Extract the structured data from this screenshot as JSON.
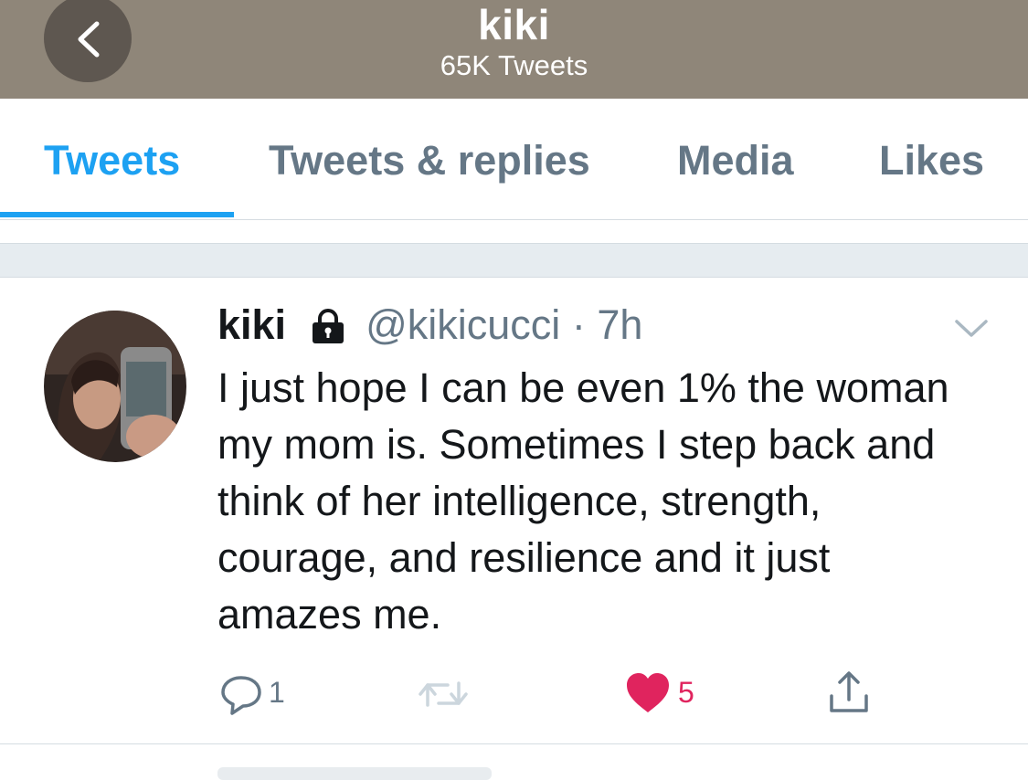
{
  "header": {
    "title": "kiki",
    "subtitle": "65K Tweets"
  },
  "tabs": [
    {
      "label": "Tweets",
      "active": true
    },
    {
      "label": "Tweets & replies",
      "active": false
    },
    {
      "label": "Media",
      "active": false
    },
    {
      "label": "Likes",
      "active": false
    }
  ],
  "tweet": {
    "name": "kiki",
    "handle": "@kikicucci",
    "separator": "·",
    "time": "7h",
    "text": "I just hope I can be even 1% the woman my mom is. Sometimes I step back and think of her intelligence, strength, courage, and resilience and it just amazes me.",
    "replies": "1",
    "likes": "5"
  },
  "colors": {
    "header_bg": "#8f8679",
    "accent": "#1da1f2",
    "like": "#e0245e",
    "muted": "#657786"
  },
  "icons": [
    "back-arrow-icon",
    "lock-icon",
    "chevron-down-icon",
    "reply-icon",
    "retweet-icon",
    "heart-icon",
    "share-icon"
  ]
}
